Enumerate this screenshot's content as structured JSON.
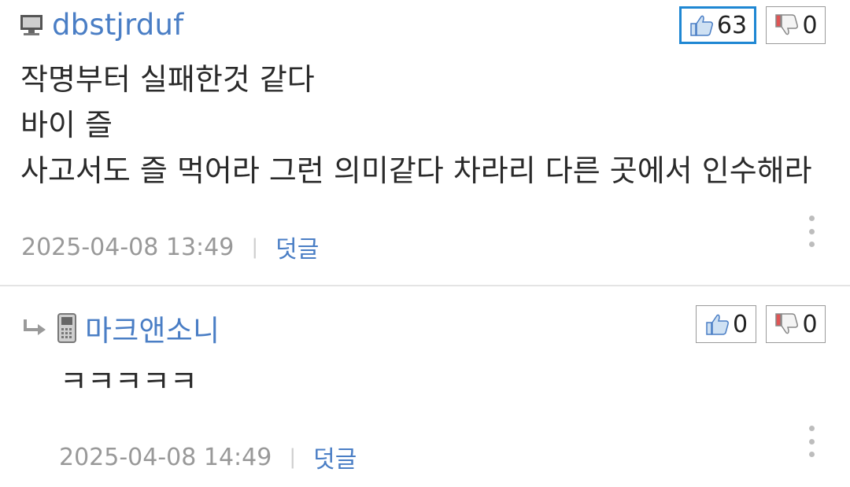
{
  "comments": [
    {
      "author": "dbstjrduf",
      "device_icon": "desktop-icon",
      "upvotes": "63",
      "downvotes": "0",
      "lines": [
        "작명부터 실패한것 같다",
        "바이 즐",
        "사고서도 즐 먹어라 그런 의미같다 차라리 다른 곳에서 인수해라"
      ],
      "date": "2025-04-08 13:49",
      "separator": "|",
      "reply_label": "덧글"
    },
    {
      "author": "마크앤소니",
      "device_icon": "mobile-phone-icon",
      "is_reply": true,
      "upvotes": "0",
      "downvotes": "0",
      "lines": [
        "ㅋㅋㅋㅋㅋ"
      ],
      "date": "2025-04-08 14:49",
      "separator": "|",
      "reply_label": "덧글"
    }
  ],
  "colors": {
    "author": "#4a7ec5",
    "active_vote_border": "#1f87d3",
    "date": "#999999",
    "divider": "#e4e4e4"
  }
}
